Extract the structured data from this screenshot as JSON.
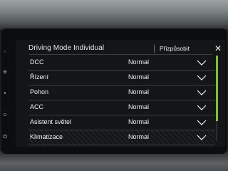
{
  "header": {
    "title": "Driving Mode Individual",
    "action_label": "Přizpůsobit",
    "close_glyph": "✕"
  },
  "settings": [
    {
      "label": "DCC",
      "value": "Normal"
    },
    {
      "label": "Řízení",
      "value": "Normal"
    },
    {
      "label": "Pohon",
      "value": "Normal"
    },
    {
      "label": "ACC",
      "value": "Normal"
    },
    {
      "label": "Asistent světel",
      "value": "Normal"
    },
    {
      "label": "Klimatizace",
      "value": "Normal"
    }
  ],
  "left_strip_icons": [
    "home-icon",
    "menu-icon",
    "settings-icon",
    "media-icon",
    "power-icon"
  ],
  "colors": {
    "accent": "#7ec23a",
    "text": "#f0f2f4",
    "background": "#131517"
  }
}
